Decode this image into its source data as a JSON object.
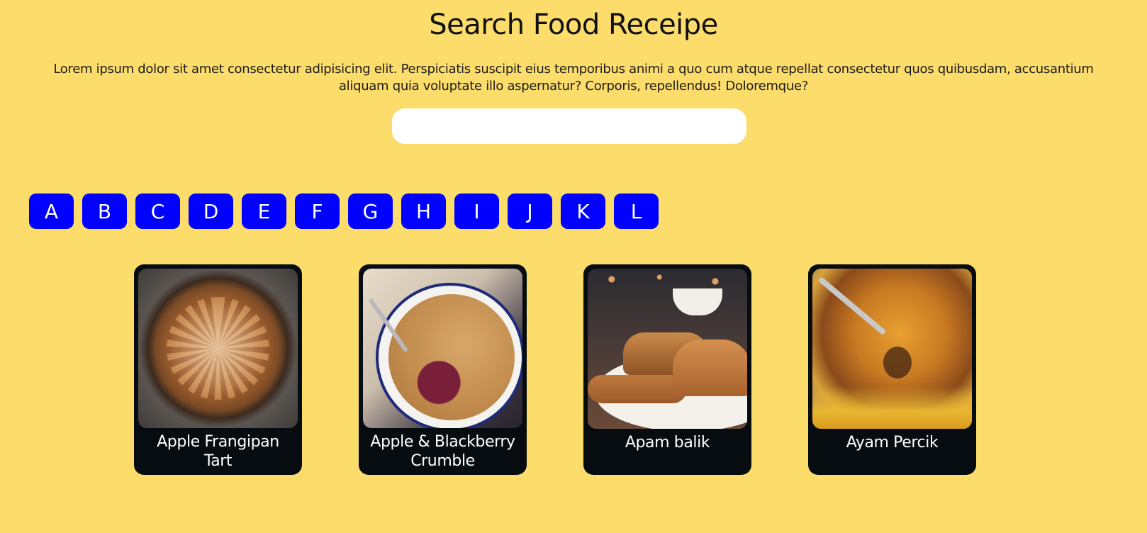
{
  "header": {
    "title": "Search Food Receipe",
    "intro": "Lorem ipsum dolor sit amet consectetur adipisicing elit. Perspiciatis suscipit eius temporibus animi a quo cum atque repellat consectetur quos quibusdam, accusantium aliquam quia voluptate illo aspernatur? Corporis, repellendus! Doloremque?"
  },
  "search": {
    "value": "",
    "placeholder": ""
  },
  "letters": [
    "A",
    "B",
    "C",
    "D",
    "E",
    "F",
    "G",
    "H",
    "I",
    "J",
    "K",
    "L"
  ],
  "recipes": [
    {
      "title": "Apple Frangipan Tart",
      "image": "tart-photo"
    },
    {
      "title": "Apple & Blackberry Crumble",
      "image": "crumble-photo"
    },
    {
      "title": "Apam balik",
      "image": "apam-photo"
    },
    {
      "title": "Ayam Percik",
      "image": "ayam-photo"
    }
  ],
  "colors": {
    "background": "#fcdc6a",
    "letter_button": "#0000ff",
    "card": "#060c10"
  }
}
